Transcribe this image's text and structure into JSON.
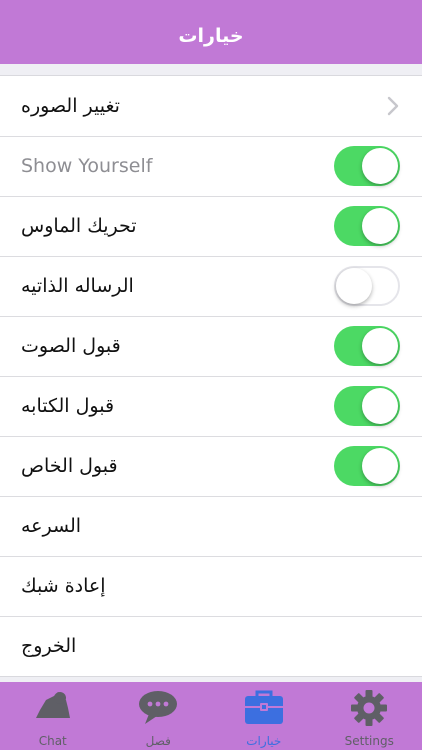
{
  "header": {
    "title": "خيارات"
  },
  "settings": {
    "rows": [
      {
        "label": "تغيير الصوره",
        "type": "link"
      },
      {
        "label": "Show Yourself",
        "type": "toggle",
        "on": true
      },
      {
        "label": "تحريك الماوس",
        "type": "toggle",
        "on": true
      },
      {
        "label": "الرساله الذاتيه",
        "type": "toggle",
        "on": false
      },
      {
        "label": "قبول الصوت",
        "type": "toggle",
        "on": true
      },
      {
        "label": "قبول الكتابه",
        "type": "toggle",
        "on": true
      },
      {
        "label": "قبول الخاص",
        "type": "toggle",
        "on": true
      },
      {
        "label": "السرعه",
        "type": "plain"
      },
      {
        "label": "إعادة شبك",
        "type": "plain"
      },
      {
        "label": "الخروج",
        "type": "plain"
      }
    ]
  },
  "tabbar": {
    "tabs": [
      {
        "label": "Chat",
        "icon": "chat-icon",
        "active": false
      },
      {
        "label": "فصل",
        "icon": "speech-bubble-icon",
        "active": false
      },
      {
        "label": "خيارات",
        "icon": "toolbox-icon",
        "active": true
      },
      {
        "label": "Settings",
        "icon": "gear-icon",
        "active": false
      }
    ]
  },
  "colors": {
    "brand": "#c179d6",
    "toggle_on": "#4cd964",
    "tab_active": "#3c6fe0",
    "tab_inactive": "#5f5f66"
  }
}
